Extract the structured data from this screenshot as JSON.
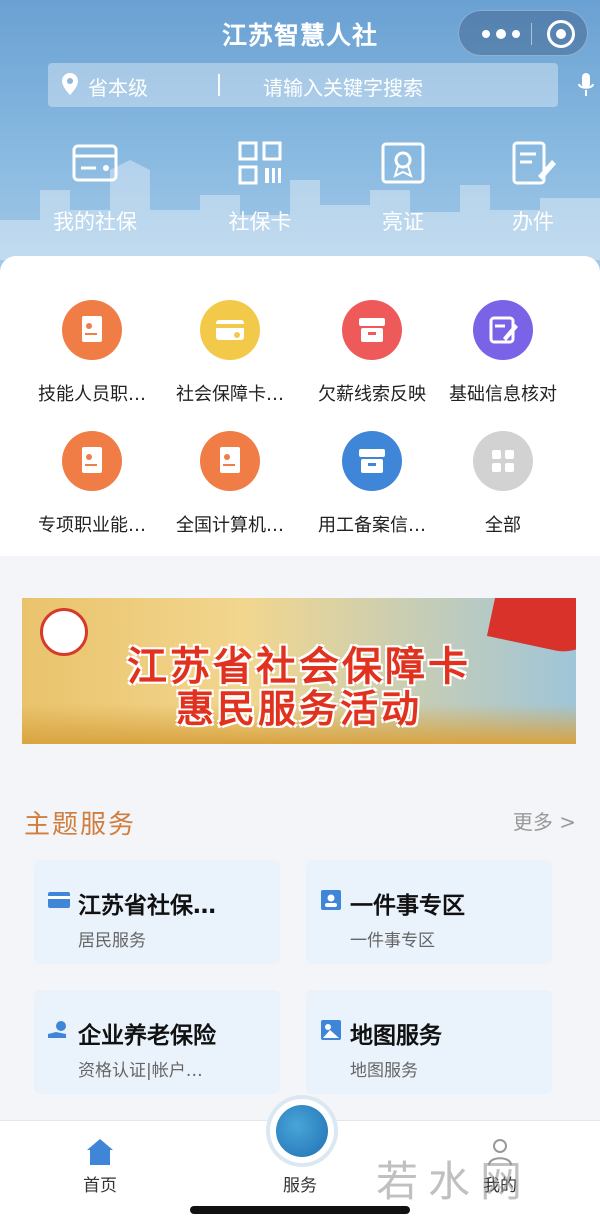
{
  "header": {
    "title": "江苏智慧人社"
  },
  "search": {
    "region": "省本级",
    "placeholder": "请输入关键字搜索"
  },
  "quick_links": [
    {
      "label": "我的社保",
      "icon": "card-icon"
    },
    {
      "label": "社保卡",
      "icon": "qrcode-icon"
    },
    {
      "label": "亮证",
      "icon": "certificate-icon"
    },
    {
      "label": "办件",
      "icon": "edit-document-icon"
    }
  ],
  "services": [
    {
      "label": "技能人员职…",
      "icon": "certificate-icon",
      "color": "#ef7d45"
    },
    {
      "label": "社会保障卡…",
      "icon": "card-icon",
      "color": "#f3c94a"
    },
    {
      "label": "欠薪线索反映",
      "icon": "inbox-icon",
      "color": "#ee5a5a"
    },
    {
      "label": "基础信息核对",
      "icon": "edit-icon",
      "color": "#7b63e8"
    },
    {
      "label": "专项职业能…",
      "icon": "certificate-icon",
      "color": "#ef7d45"
    },
    {
      "label": "全国计算机…",
      "icon": "certificate-icon",
      "color": "#ef7d45"
    },
    {
      "label": "用工备案信…",
      "icon": "inbox-icon",
      "color": "#3f86d8"
    },
    {
      "label": "全部",
      "icon": "grid-icon",
      "color": "#cfcfcf"
    }
  ],
  "banner": {
    "line1": "江苏省社会保障卡",
    "line2": "惠民服务活动"
  },
  "theme": {
    "title": "主题服务",
    "more": "更多 >",
    "cards": [
      {
        "title": "江苏省社保…",
        "subtitle": "居民服务"
      },
      {
        "title": "一件事专区",
        "subtitle": "一件事专区"
      },
      {
        "title": "企业养老保险",
        "subtitle": "资格认证|帐户…"
      },
      {
        "title": "地图服务",
        "subtitle": "地图服务"
      }
    ]
  },
  "tabs": [
    {
      "label": "首页"
    },
    {
      "label": "服务"
    },
    {
      "label": "我的"
    }
  ],
  "watermark": "若水网"
}
